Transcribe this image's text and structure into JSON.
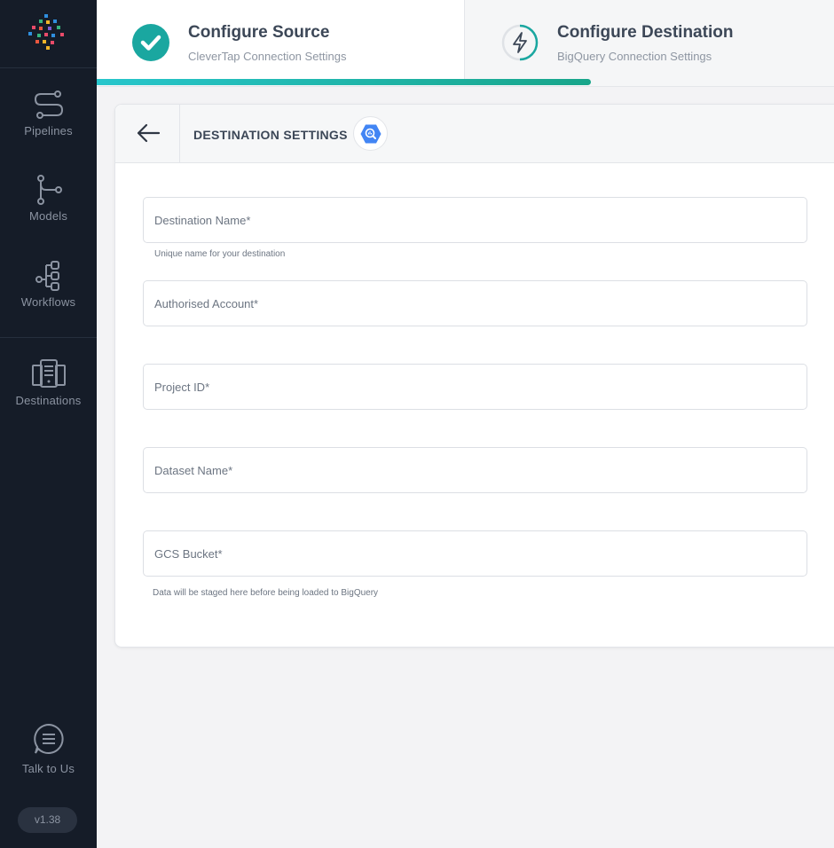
{
  "sidebar": {
    "items": [
      {
        "label": "Pipelines",
        "icon": "pipelines-icon"
      },
      {
        "label": "Models",
        "icon": "models-icon"
      },
      {
        "label": "Workflows",
        "icon": "workflows-icon"
      },
      {
        "label": "Destinations",
        "icon": "destinations-icon"
      }
    ],
    "talk_label": "Talk to Us",
    "version": "v1.38"
  },
  "stepper": {
    "steps": [
      {
        "title": "Configure Source",
        "subtitle": "CleverTap Connection Settings",
        "status": "complete"
      },
      {
        "title": "Configure Destination",
        "subtitle": "BigQuery Connection Settings",
        "status": "active"
      }
    ],
    "progress_fraction": 0.67
  },
  "card": {
    "title": "DESTINATION SETTINGS",
    "fields": [
      {
        "placeholder": "Destination Name*",
        "value": "",
        "hint": "Unique name for your destination"
      },
      {
        "placeholder": "Authorised Account*",
        "value": "",
        "hint": ""
      },
      {
        "placeholder": "Project ID*",
        "value": "",
        "hint": ""
      },
      {
        "placeholder": "Dataset Name*",
        "value": "",
        "hint": ""
      },
      {
        "placeholder": "GCS Bucket*",
        "value": "",
        "hint": "Data will be staged here before being loaded to BigQuery"
      }
    ]
  },
  "colors": {
    "sidebar_bg": "#151c28",
    "accent_teal": "#1aa7a0",
    "progress_start": "#27c6cc",
    "progress_end": "#18a58a",
    "bigquery_blue": "#4285f4"
  }
}
